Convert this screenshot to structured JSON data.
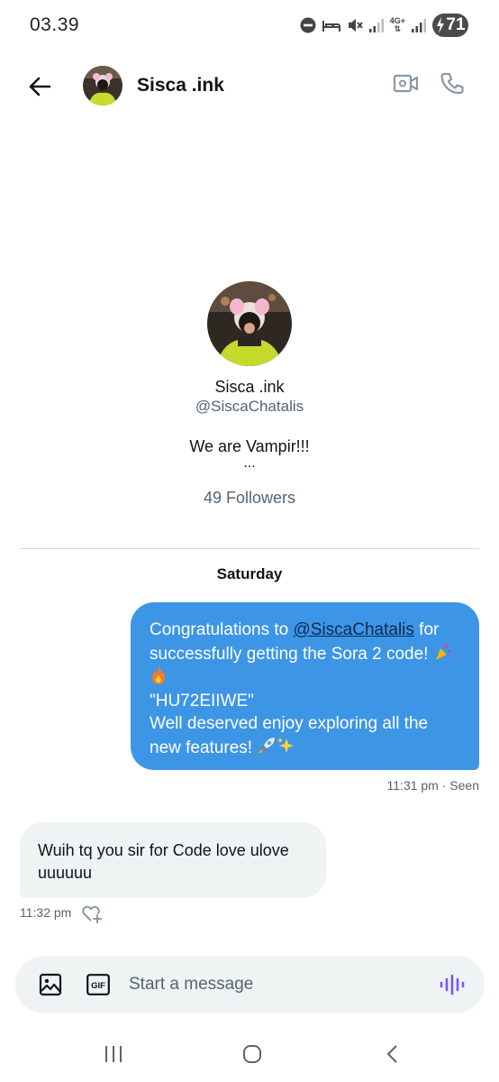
{
  "status_bar": {
    "time": "03.39",
    "network_label": "4G+",
    "battery_level": "71"
  },
  "header": {
    "title": "Sisca .ink",
    "icons": {
      "back": "arrow-left-icon",
      "video": "video-camera-icon",
      "call": "phone-icon"
    }
  },
  "profile": {
    "name": "Sisca .ink",
    "handle": "@SiscaChatalis",
    "bio": "We are Vampir!!!",
    "bio_ellipsis": "...",
    "followers": "49 Followers"
  },
  "conversation": {
    "day_label": "Saturday",
    "messages": [
      {
        "direction": "outgoing",
        "text_prefix": "Congratulations to ",
        "mention": "@SiscaChatalis",
        "text_after_mention": " for successfully getting the Sora 2 code!",
        "code": "\"HU72EIIWE\"",
        "text_closing": "Well deserved enjoy exploring all the new features!",
        "emojis": [
          "party-popper",
          "fire",
          "rocket",
          "sparkles"
        ],
        "meta": "11:31 pm · Seen",
        "color": "#3d95e6"
      },
      {
        "direction": "incoming",
        "text": "Wuih tq you sir for Code love ulove uuuuuu",
        "meta": "11:32 pm",
        "reaction_icon": "heart-plus-icon",
        "color": "#eff3f4"
      }
    ]
  },
  "composer": {
    "placeholder": "Start a message",
    "icons": {
      "media": "image-icon",
      "gif": "gif-icon",
      "voice": "voice-waveform-icon"
    },
    "gif_label": "GIF",
    "accent": "#7856ff"
  },
  "nav_bar": {
    "icons": [
      "recents-icon",
      "home-icon",
      "back-icon"
    ]
  }
}
